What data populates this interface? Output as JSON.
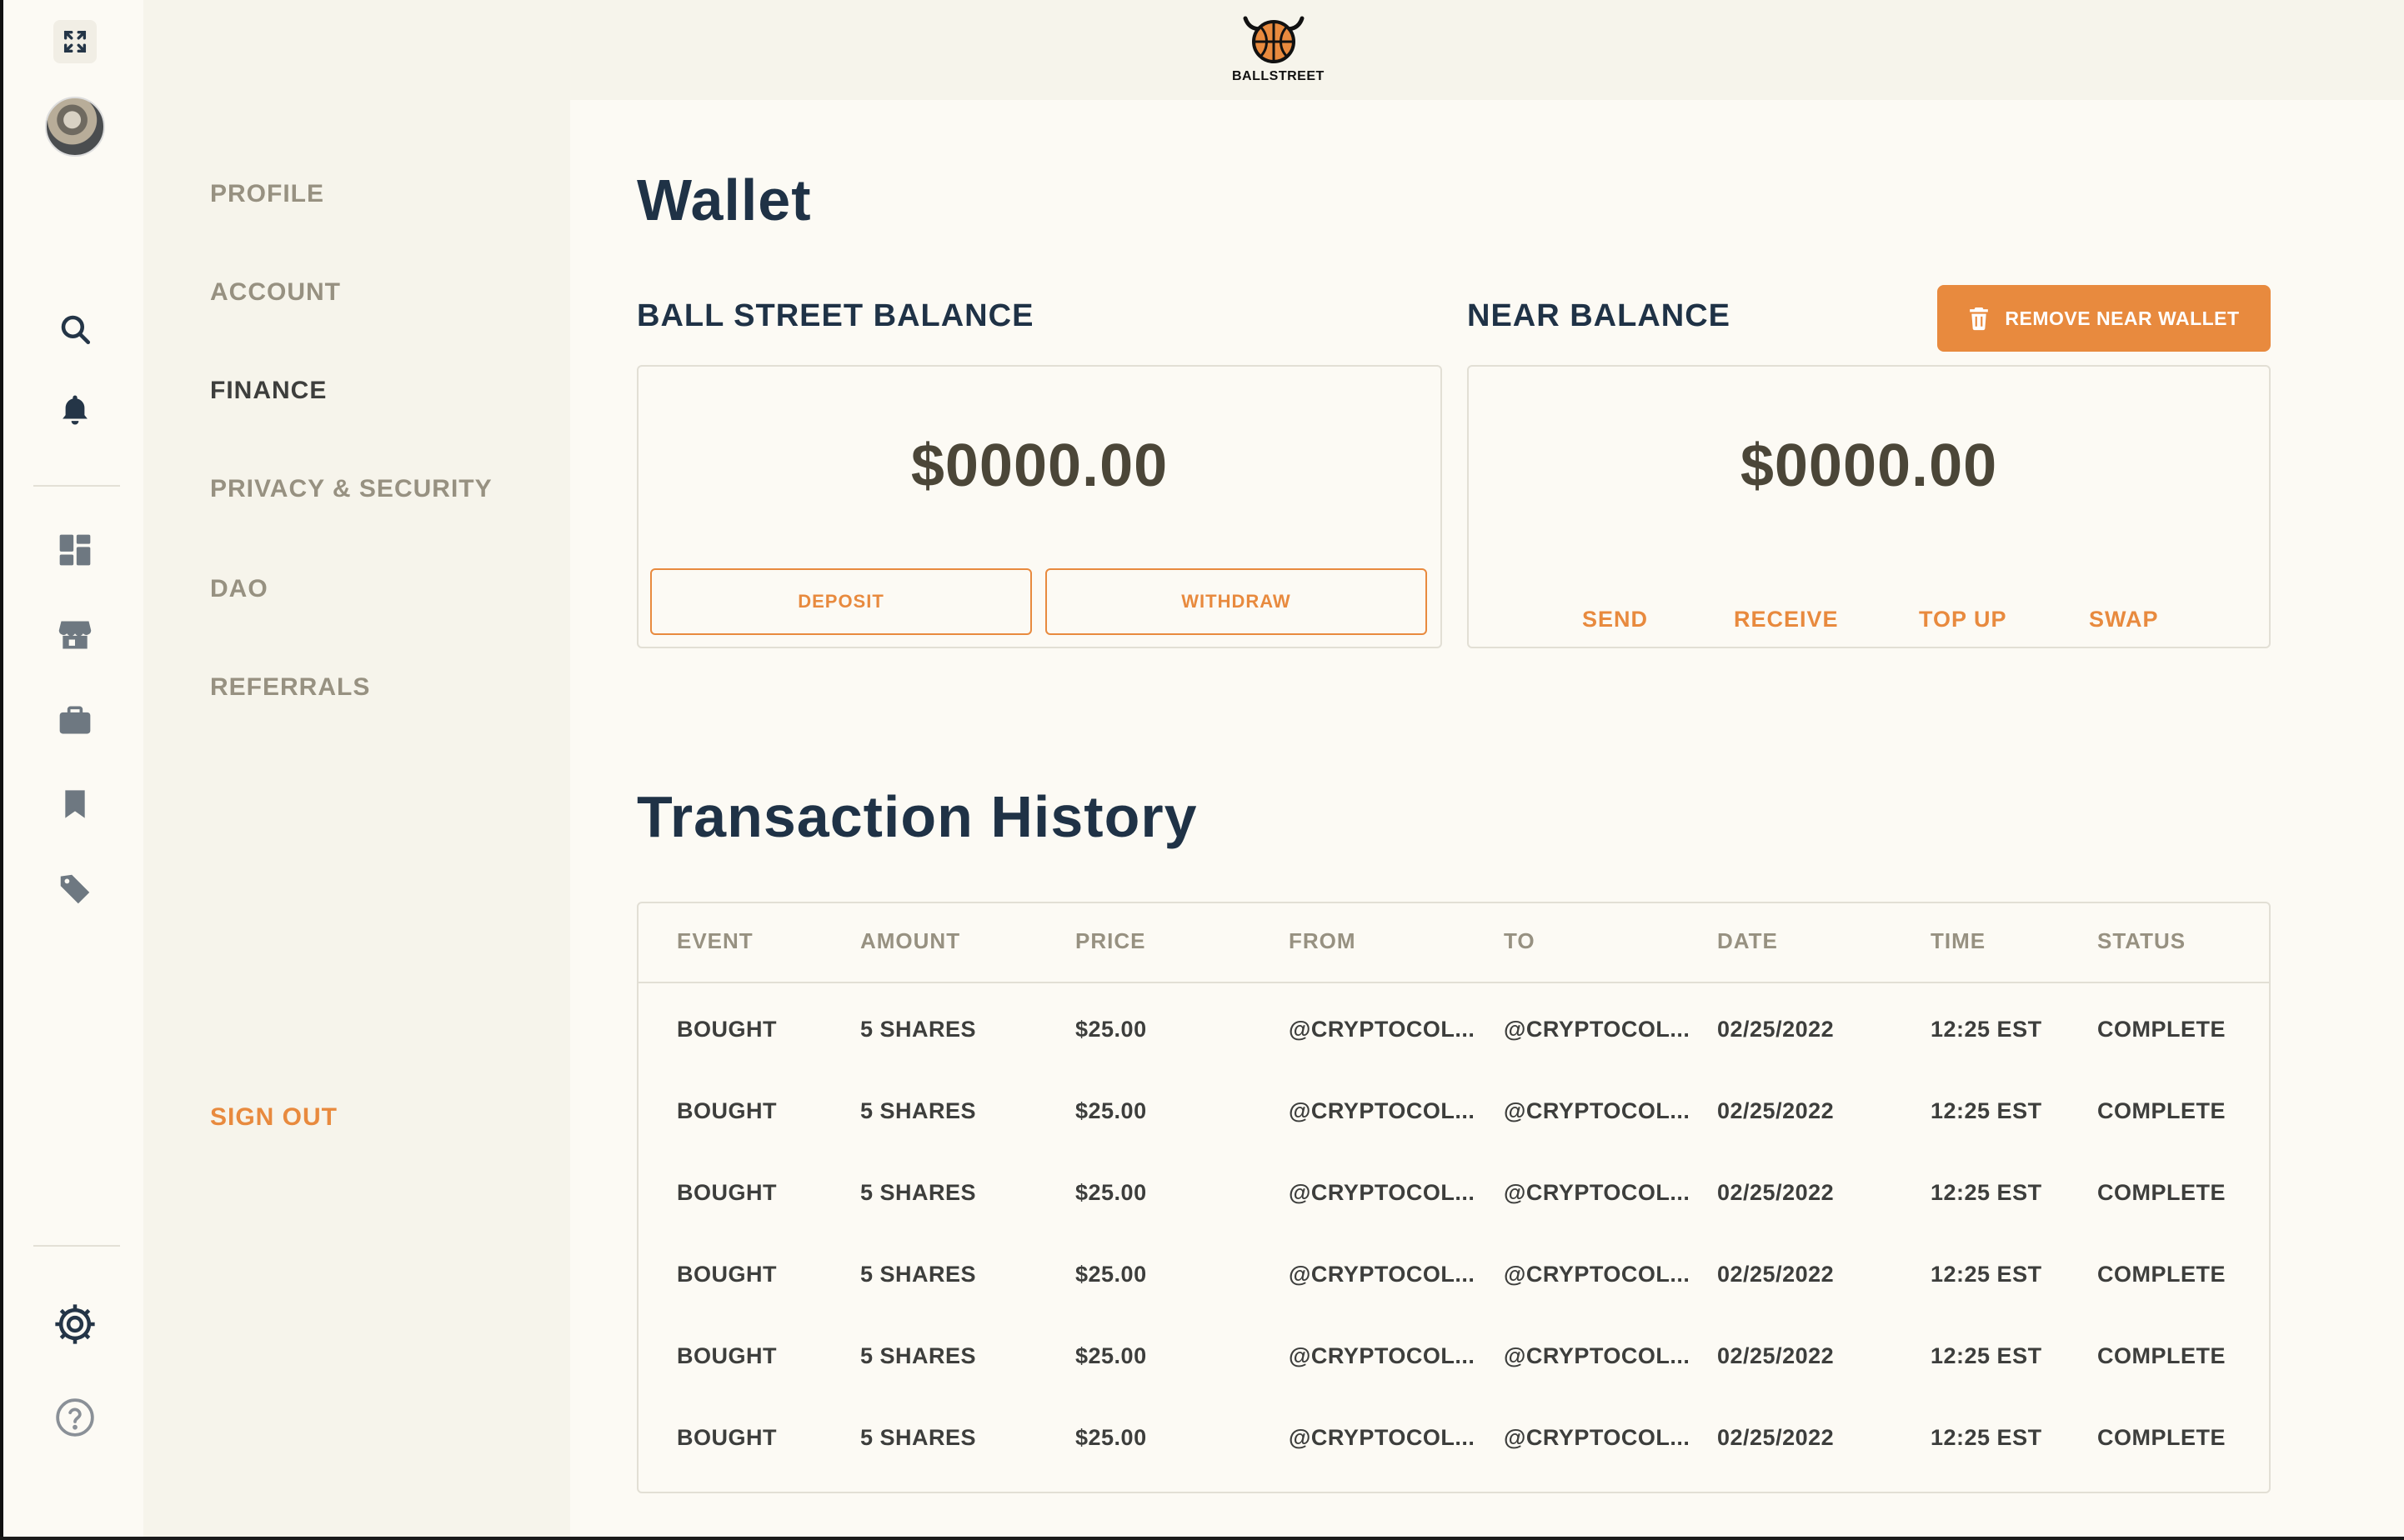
{
  "brand": {
    "name": "BALLSTREET"
  },
  "settings_nav": {
    "items": [
      {
        "label": "PROFILE"
      },
      {
        "label": "ACCOUNT"
      },
      {
        "label": "FINANCE"
      },
      {
        "label": "PRIVACY & SECURITY"
      },
      {
        "label": "DAO"
      },
      {
        "label": "REFERRALS"
      }
    ],
    "active": "FINANCE",
    "sign_out": "SIGN OUT"
  },
  "rail_icons": [
    "expand-icon",
    "avatar",
    "search-icon",
    "bell-icon",
    "dashboard-icon",
    "store-icon",
    "briefcase-icon",
    "bookmark-icon",
    "tag-icon",
    "settings-icon",
    "help-icon"
  ],
  "wallet": {
    "title": "Wallet",
    "ballstreet": {
      "label": "BALL STREET BALANCE",
      "amount": "$0000.00",
      "deposit": "DEPOSIT",
      "withdraw": "WITHDRAW"
    },
    "near": {
      "label": "NEAR BALANCE",
      "remove_button": "REMOVE NEAR WALLET",
      "amount": "$0000.00",
      "actions": [
        "SEND",
        "RECEIVE",
        "TOP UP",
        "SWAP"
      ]
    }
  },
  "history": {
    "title": "Transaction History",
    "columns": [
      "EVENT",
      "AMOUNT",
      "PRICE",
      "FROM",
      "TO",
      "DATE",
      "TIME",
      "STATUS"
    ],
    "rows": [
      [
        "BOUGHT",
        "5 SHARES",
        "$25.00",
        "@CRYPTOCOL...",
        "@CRYPTOCOL...",
        "02/25/2022",
        "12:25 EST",
        "COMPLETE"
      ],
      [
        "BOUGHT",
        "5 SHARES",
        "$25.00",
        "@CRYPTOCOL...",
        "@CRYPTOCOL...",
        "02/25/2022",
        "12:25 EST",
        "COMPLETE"
      ],
      [
        "BOUGHT",
        "5 SHARES",
        "$25.00",
        "@CRYPTOCOL...",
        "@CRYPTOCOL...",
        "02/25/2022",
        "12:25 EST",
        "COMPLETE"
      ],
      [
        "BOUGHT",
        "5 SHARES",
        "$25.00",
        "@CRYPTOCOL...",
        "@CRYPTOCOL...",
        "02/25/2022",
        "12:25 EST",
        "COMPLETE"
      ],
      [
        "BOUGHT",
        "5 SHARES",
        "$25.00",
        "@CRYPTOCOL...",
        "@CRYPTOCOL...",
        "02/25/2022",
        "12:25 EST",
        "COMPLETE"
      ],
      [
        "BOUGHT",
        "5 SHARES",
        "$25.00",
        "@CRYPTOCOL...",
        "@CRYPTOCOL...",
        "02/25/2022",
        "12:25 EST",
        "COMPLETE"
      ]
    ]
  },
  "colors": {
    "accent": "#E88A3E",
    "heading": "#1F3246",
    "muted": "#979181",
    "text": "#3D3E3C",
    "background": "#F6F4EB",
    "panel": "#FCFAF4"
  }
}
